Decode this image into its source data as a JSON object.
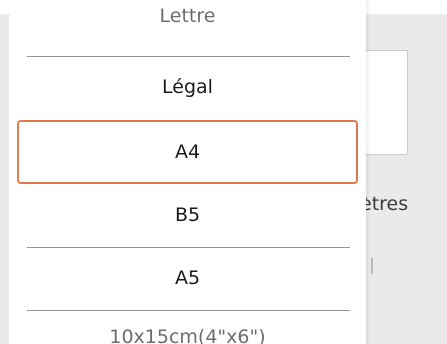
{
  "background": {
    "partial_label": "ètres"
  },
  "paper_size_list": {
    "options": [
      "Lettre",
      "Légal",
      "A4",
      "B5",
      "A5",
      "10x15cm(4\"x6\")"
    ],
    "selected": "A4"
  },
  "colors": {
    "selection_border": "#e07a4a",
    "divider": "#9a9697",
    "background": "#ece9ea"
  }
}
